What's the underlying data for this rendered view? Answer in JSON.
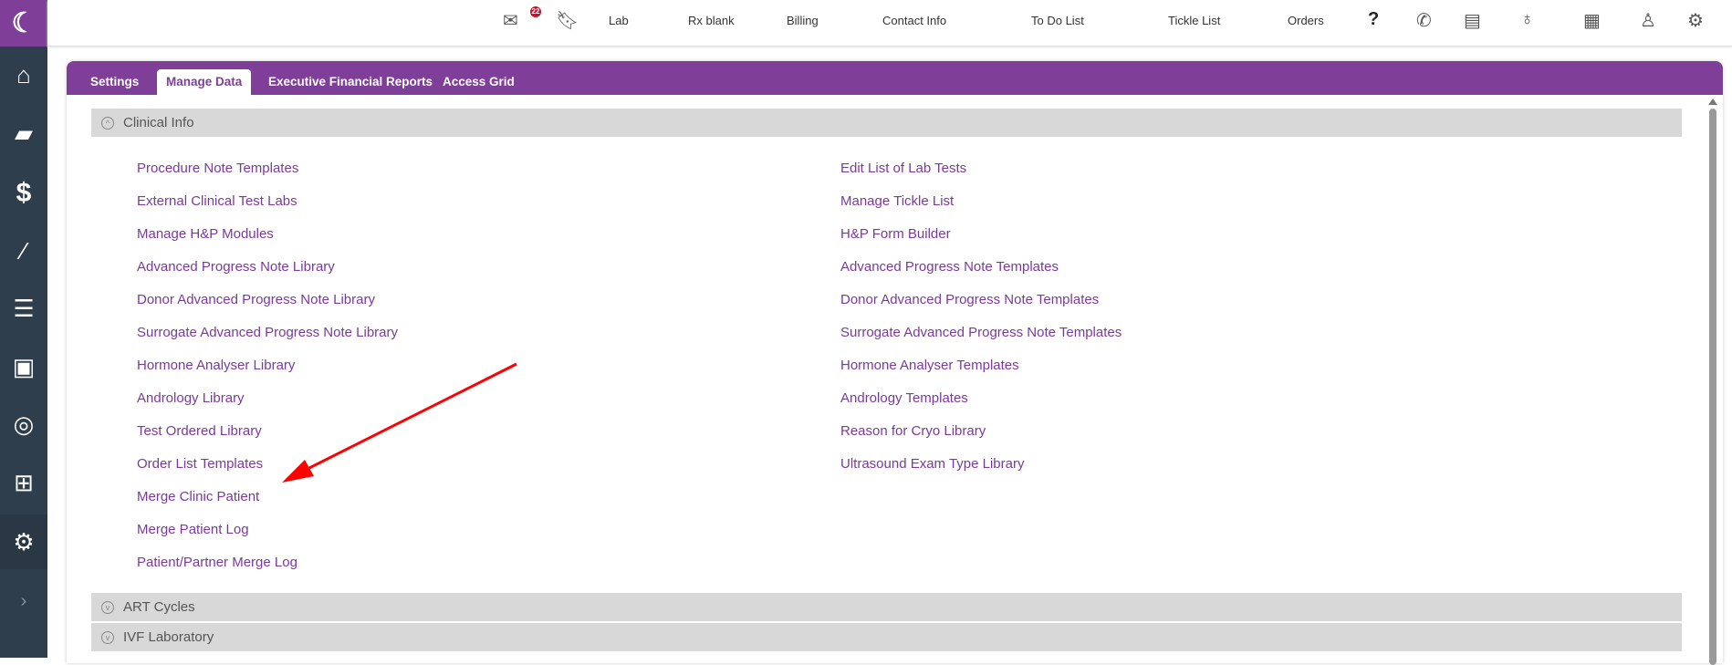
{
  "topnav": {
    "mail_badge": "22",
    "items": [
      "Lab",
      "Rx blank",
      "Billing",
      "Contact Info",
      "To Do List",
      "Tickle List",
      "Orders"
    ]
  },
  "tabs": [
    "Settings",
    "Manage Data",
    "Executive Financial Reports",
    "Access Grid"
  ],
  "sections": {
    "clinical": "Clinical Info",
    "art": "ART Cycles",
    "ivf": "IVF Laboratory"
  },
  "links_left": [
    "Procedure Note Templates",
    "External Clinical Test Labs",
    "Manage H&P Modules",
    "Advanced Progress Note Library",
    "Donor Advanced Progress Note Library",
    "Surrogate Advanced Progress Note Library",
    "Hormone Analyser Library",
    "Andrology Library",
    "Test Ordered Library",
    "Order List Templates",
    "Merge Clinic Patient",
    "Merge Patient Log",
    "Patient/Partner Merge Log"
  ],
  "links_right": [
    "Edit List of Lab Tests",
    "Manage Tickle List",
    "H&P Form Builder",
    "Advanced Progress Note Templates",
    "Donor Advanced Progress Note Templates",
    "Surrogate Advanced Progress Note Templates",
    "Hormone Analyser Templates",
    "Andrology Templates",
    "Reason for Cryo Library",
    "Ultrasound Exam Type Library"
  ],
  "colors": {
    "brand": "#7f3f98",
    "sidebar": "#2f3e4c",
    "annotation": "#ff0000"
  }
}
